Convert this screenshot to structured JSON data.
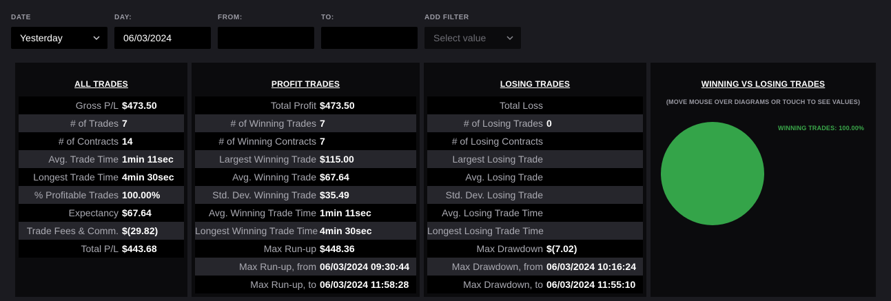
{
  "filters": {
    "date": {
      "label": "DATE",
      "value": "Yesterday"
    },
    "day": {
      "label": "DAY:",
      "value": "06/03/2024"
    },
    "from": {
      "label": "FROM:",
      "value": ""
    },
    "to": {
      "label": "TO:",
      "value": ""
    },
    "add_filter": {
      "label": "ADD FILTER",
      "placeholder": "Select value"
    }
  },
  "all_trades": {
    "title": "ALL TRADES",
    "rows": [
      {
        "label": "Gross P/L",
        "value": "$473.50"
      },
      {
        "label": "# of Trades",
        "value": "7"
      },
      {
        "label": "# of Contracts",
        "value": "14"
      },
      {
        "label": "Avg. Trade Time",
        "value": "1min 11sec"
      },
      {
        "label": "Longest Trade Time",
        "value": "4min 30sec"
      },
      {
        "label": "% Profitable Trades",
        "value": "100.00%"
      },
      {
        "label": "Expectancy",
        "value": "$67.64"
      },
      {
        "label": "Trade Fees & Comm.",
        "value": "$(29.82)"
      },
      {
        "label": "Total P/L",
        "value": "$443.68"
      }
    ]
  },
  "profit_trades": {
    "title": "PROFIT TRADES",
    "rows": [
      {
        "label": "Total Profit",
        "value": "$473.50"
      },
      {
        "label": "# of Winning Trades",
        "value": "7"
      },
      {
        "label": "# of Winning Contracts",
        "value": "7"
      },
      {
        "label": "Largest Winning Trade",
        "value": "$115.00"
      },
      {
        "label": "Avg. Winning Trade",
        "value": "$67.64"
      },
      {
        "label": "Std. Dev. Winning Trade",
        "value": "$35.49"
      },
      {
        "label": "Avg. Winning Trade Time",
        "value": "1min 11sec"
      },
      {
        "label": "Longest Winning Trade Time",
        "value": "4min 30sec"
      },
      {
        "label": "Max Run-up",
        "value": "$448.36"
      },
      {
        "label": "Max Run-up, from",
        "value": "06/03/2024 09:30:44"
      },
      {
        "label": "Max Run-up, to",
        "value": "06/03/2024 11:58:28"
      }
    ]
  },
  "losing_trades": {
    "title": "LOSING TRADES",
    "rows": [
      {
        "label": "Total Loss",
        "value": ""
      },
      {
        "label": "# of Losing Trades",
        "value": "0"
      },
      {
        "label": "# of Losing Contracts",
        "value": ""
      },
      {
        "label": "Largest Losing Trade",
        "value": ""
      },
      {
        "label": "Avg. Losing Trade",
        "value": ""
      },
      {
        "label": "Std. Dev. Losing Trade",
        "value": ""
      },
      {
        "label": "Avg. Losing Trade Time",
        "value": ""
      },
      {
        "label": "Longest Losing Trade Time",
        "value": ""
      },
      {
        "label": "Max Drawdown",
        "value": "$(7.02)"
      },
      {
        "label": "Max Drawdown, from",
        "value": "06/03/2024 10:16:24"
      },
      {
        "label": "Max Drawdown, to",
        "value": "06/03/2024 11:55:10"
      }
    ]
  },
  "winning_vs_losing": {
    "title": "WINNING VS LOSING TRADES",
    "subtitle": "(MOVE MOUSE OVER DIAGRAMS OR TOUCH TO SEE VALUES)",
    "legend": "WINNING TRADES: 100.00%"
  },
  "chart_data": {
    "type": "pie",
    "title": "WINNING VS LOSING TRADES",
    "slices": [
      {
        "name": "WINNING TRADES",
        "value": 100.0,
        "color": "#34a449"
      }
    ]
  },
  "colors": {
    "background": "#1b1b20",
    "panel": "#0b0b0d",
    "row_alt": "#26262c",
    "win_green": "#34a449"
  }
}
